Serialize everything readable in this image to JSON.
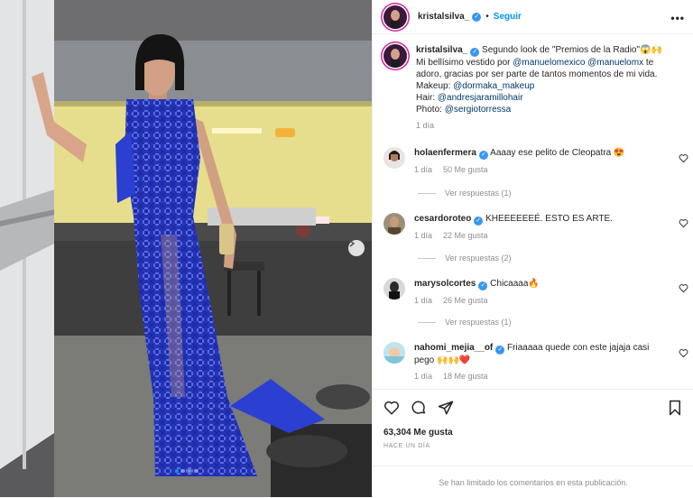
{
  "header": {
    "username": "kristalsilva_",
    "follow_label": "Seguir",
    "more_icon": "ellipsis"
  },
  "caption": {
    "username": "kristalsilva_",
    "line1": "Segundo look de \"Premios de la Radio\"😱🙌",
    "line2_prefix": "Mi bellísimo vestido por ",
    "mention1": "@manuelomexico",
    "mention2": "@manuelomx",
    "line2_suffix": " te",
    "line3": "adoro, gracias por ser parte de tantos momentos de mi vida.",
    "makeup_label": "Makeup: ",
    "makeup_mention": "@dormaka_makeup",
    "hair_label": "Hair: ",
    "hair_mention": "@andresjaramillohair",
    "photo_label": "Photo: ",
    "photo_mention": "@sergiotorressa",
    "time": "1 día"
  },
  "comments": [
    {
      "username": "holaenfermera",
      "text": "Aaaay ese pelito de Cleopatra 😍",
      "time": "1 día",
      "likes": "50 Me gusta",
      "replies": "Ver respuestas (1)"
    },
    {
      "username": "cesardoroteo",
      "text": "KHEEEEEEÉ. ESTO ES ARTE.",
      "time": "1 día",
      "likes": "22 Me gusta",
      "replies": "Ver respuestas (2)"
    },
    {
      "username": "marysolcortes",
      "text": "Chicaaaa🔥",
      "time": "1 día",
      "likes": "26 Me gusta",
      "replies": "Ver respuestas (1)"
    },
    {
      "username": "nahomi_mejia__of",
      "text": "Friaaaaa quede con este jajaja casi",
      "text2": "pego 🙌🙌❤️",
      "time": "1 día",
      "likes": "18 Me gusta"
    }
  ],
  "actions": {
    "icons": [
      "heart-icon",
      "comment-icon",
      "share-icon",
      "bookmark-icon"
    ],
    "likes": "63,304 Me gusta",
    "date": "HACE UN DÍA",
    "limited_text": "Se han limitado los comentarios en esta publicación."
  },
  "carousel": {
    "total_slides": 4,
    "active_slide": 1
  },
  "colors": {
    "accent": "#0095f6",
    "verified": "#3897f0",
    "dress": "#2b3fd0",
    "mention": "#00376b"
  }
}
